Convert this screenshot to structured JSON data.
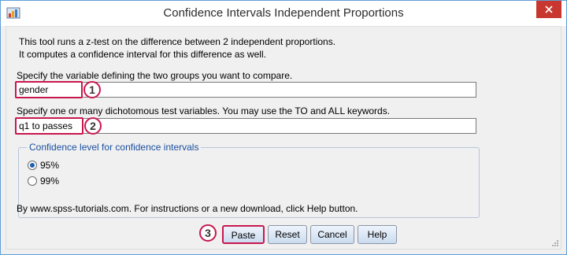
{
  "window": {
    "title": "Confidence Intervals Independent Proportions"
  },
  "intro": {
    "line1": "This tool runs a z-test on the difference between 2 independent proportions.",
    "line2": " It computes a confidence interval for this difference as well."
  },
  "groups_field": {
    "label": "Specify the variable defining the two groups you want to compare.",
    "value": "gender",
    "badge": "1"
  },
  "test_field": {
    "label": "Specify one or many dichotomous test variables. You may use the TO and ALL keywords.",
    "value": "q1 to passes",
    "badge": "2"
  },
  "confidence": {
    "title": "Confidence level for confidence intervals",
    "options": [
      {
        "label": "95%",
        "selected": true
      },
      {
        "label": "99%",
        "selected": false
      }
    ]
  },
  "footer_note": "By www.spss-tutorials.com. For instructions or a new download, click Help button.",
  "buttons": {
    "badge": "3",
    "paste": "Paste",
    "reset": "Reset",
    "cancel": "Cancel",
    "help": "Help"
  },
  "colors": {
    "highlight": "#c8174f",
    "close": "#c7372f",
    "accent": "#1a4fa0"
  }
}
